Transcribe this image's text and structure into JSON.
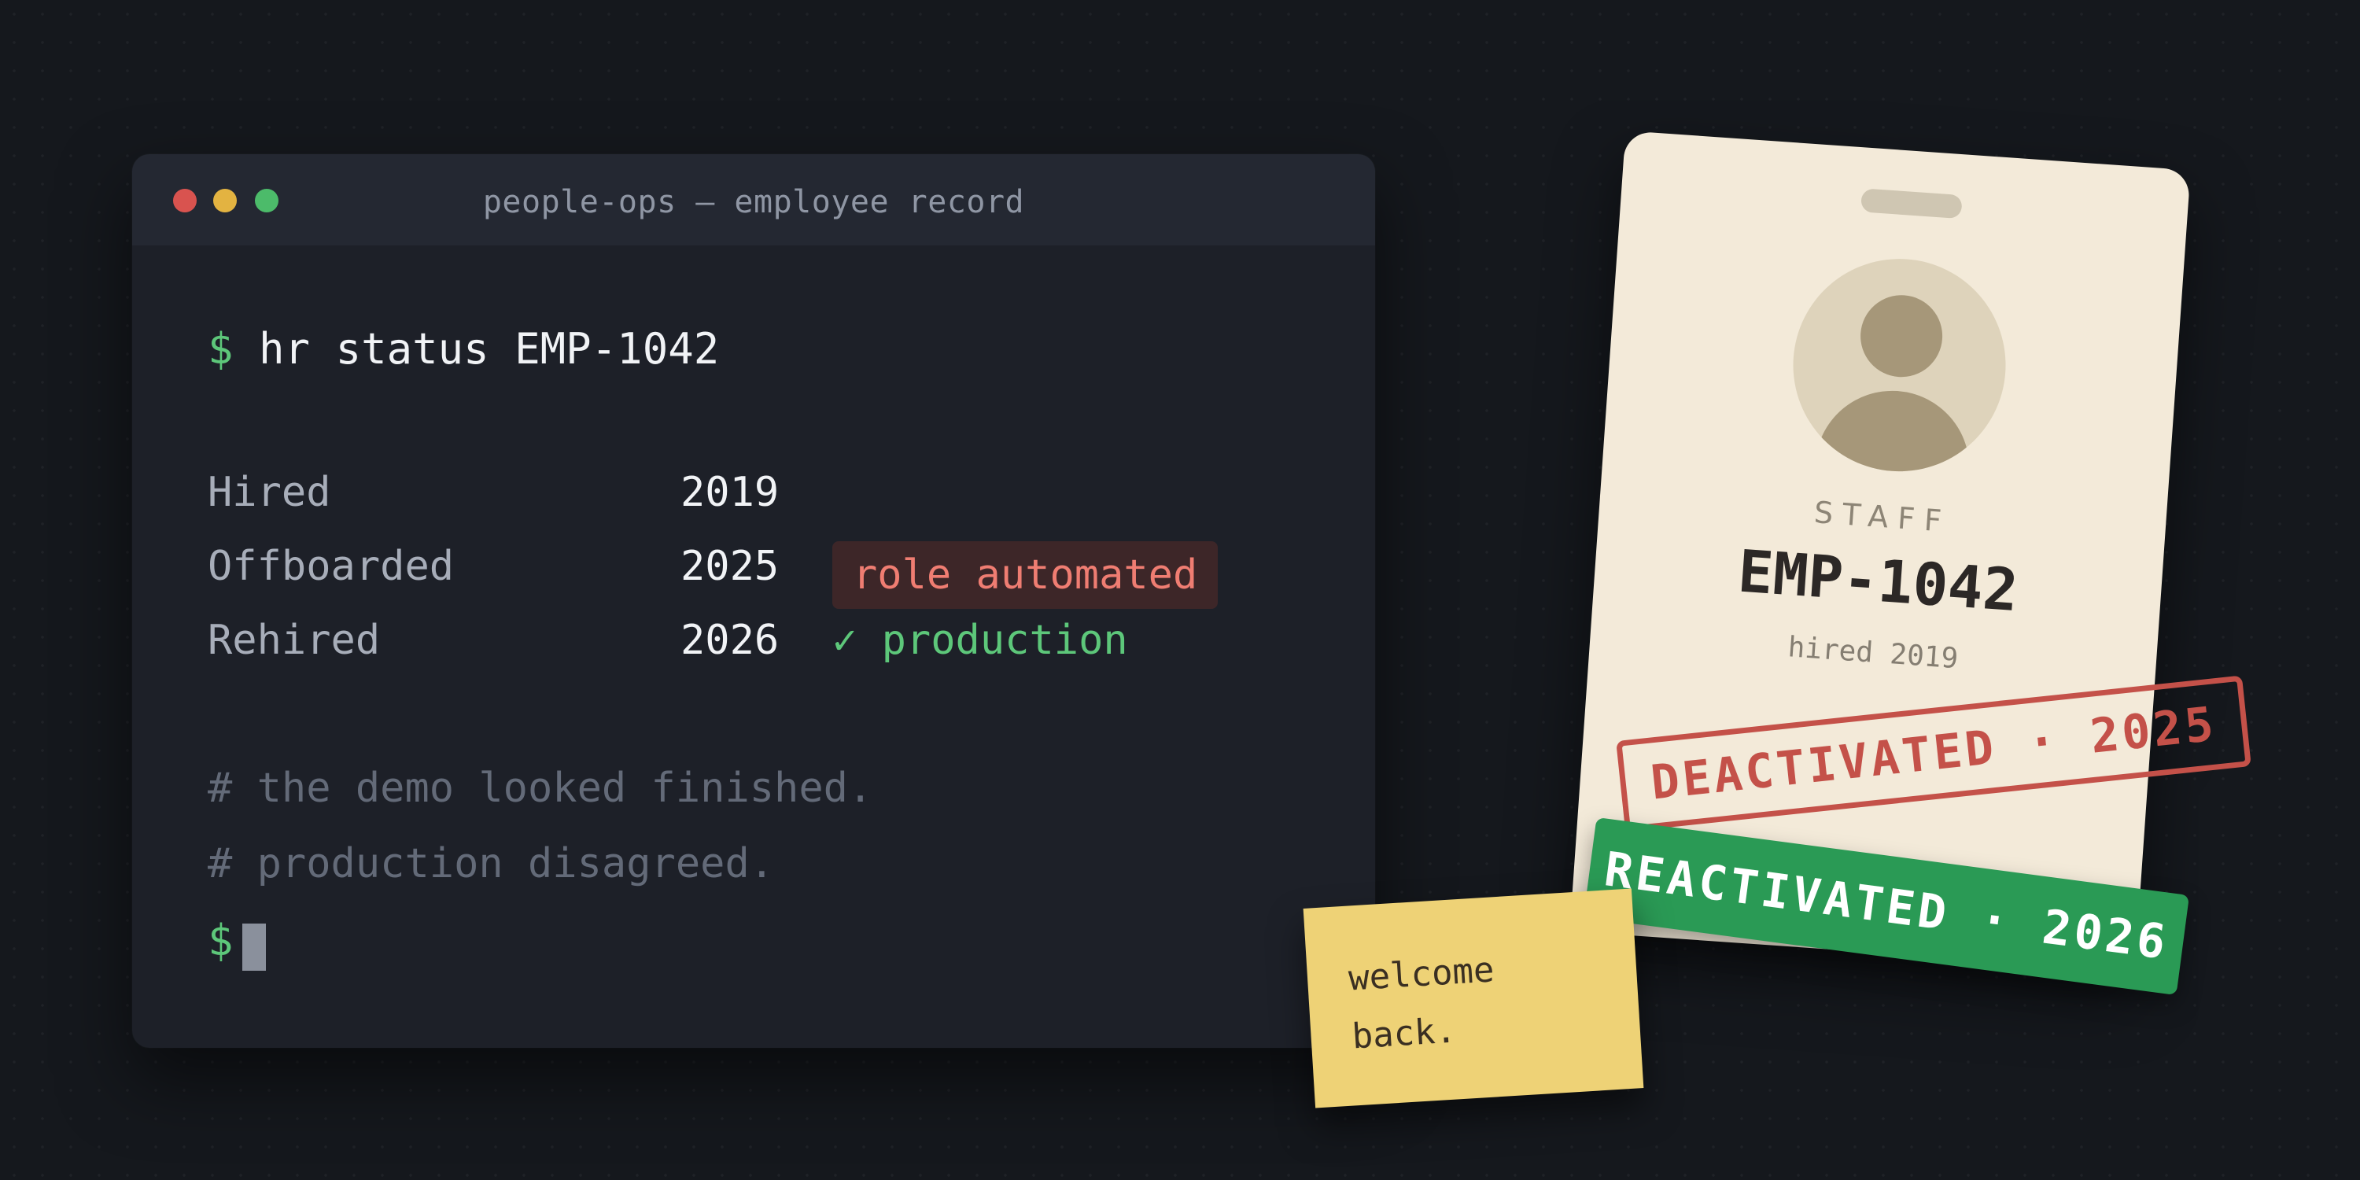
{
  "window": {
    "title": "people-ops — employee record",
    "controls": {
      "close_color": "#d9534f",
      "minimize_color": "#e3b341",
      "maximize_color": "#4cbb6a"
    }
  },
  "terminal": {
    "prompt_symbol": "$",
    "command": "hr status EMP-1042",
    "rows": [
      {
        "label": "Hired",
        "year": "2019",
        "note": ""
      },
      {
        "label": "Offboarded",
        "year": "2025",
        "note": "role automated"
      },
      {
        "label": "Rehired",
        "year": "2026",
        "note": "✓ production"
      }
    ],
    "comments": [
      "# the demo looked finished.",
      "# production disagreed."
    ],
    "final_prompt": "$"
  },
  "badge": {
    "role": "STAFF",
    "id": "EMP-1042",
    "hired": "hired 2019",
    "icon": "user-avatar-icon"
  },
  "stamps": {
    "deactivated": "DEACTIVATED · 2025",
    "reactivated": "REACTIVATED · 2026"
  },
  "sticky_note": {
    "text": "welcome\nback."
  },
  "colors": {
    "background": "#15181d",
    "terminal_bg": "#1d2028",
    "accent_green": "#5dc77a",
    "accent_red": "#ef7d72",
    "stamp_red": "#c45149",
    "stamp_green": "#2a9a55",
    "badge_bg": "#f3ead9",
    "sticky_bg": "#eed276"
  }
}
